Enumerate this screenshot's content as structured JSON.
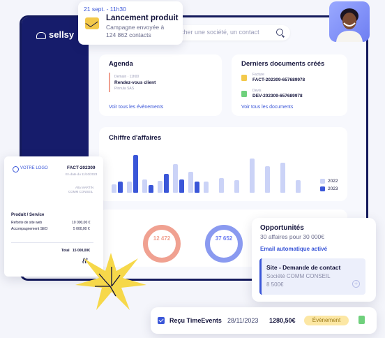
{
  "notification": {
    "date": "21 sept. - 11h30",
    "title": "Lancement produit",
    "line1": "Campagne envoyée à",
    "line2": "124 862 contacts"
  },
  "sidebar": {
    "logo": "sellsy"
  },
  "search": {
    "placeholder": "rcher une société, un contact"
  },
  "agenda": {
    "title": "Agenda",
    "time": "Demain · 11h00",
    "event": "Rendez-vous client",
    "company": "Pinnula SAS",
    "link": "Voir tous les évènements"
  },
  "documents": {
    "title": "Derniers documents créés",
    "items": [
      {
        "type": "Facture",
        "ref": "FACT-202309-657689978",
        "color": "#f3c94b"
      },
      {
        "type": "Devis",
        "ref": "DEV-202309-657689978",
        "color": "#6fd07c"
      }
    ],
    "link": "Voir tous les documents"
  },
  "revenue": {
    "title": "Chiffre d'affaires",
    "legend": [
      {
        "label": "2022",
        "color": "#cbd3f7"
      },
      {
        "label": "2023",
        "color": "#3a56d8"
      }
    ],
    "bars": [
      [
        0.22,
        0.3
      ],
      [
        0.3,
        1.0
      ],
      [
        0.35,
        0.2
      ],
      [
        0.32,
        0.5
      ],
      [
        0.76,
        0.35
      ],
      [
        0.55,
        0.3
      ],
      [
        0.29,
        0.0
      ],
      [
        0.38,
        0.0
      ],
      [
        0.33,
        0.0
      ],
      [
        0.9,
        0.0
      ],
      [
        0.71,
        0.0
      ],
      [
        0.8,
        0.0
      ],
      [
        0.33,
        0.0
      ]
    ]
  },
  "gauges": [
    {
      "value": "12 472",
      "color": "#f0a191"
    },
    {
      "value": "37 652",
      "color": "#8a9af0"
    }
  ],
  "invoice": {
    "logo": "VOTRE LOGO",
    "ref": "FACT-202309",
    "date": "En date du 11/10/2023",
    "client1": "Alta MARTIN",
    "client2": "COMM CONSEIL",
    "section": "Produit / Service",
    "lines": [
      {
        "label": "Refonte de site web",
        "amount": "10 000,00 €"
      },
      {
        "label": "Accompagnement SEO",
        "amount": "5 000,00 €"
      }
    ],
    "total_label": "Total",
    "total": "15 000,00€",
    "signature": "ℓℓ"
  },
  "opportunities": {
    "title": "Opportunités",
    "subtitle": "30 affaires pour 30 000€",
    "auto_email": "Email automatique activé",
    "card_title": "Site - Demande de contact",
    "card_company": "Société COMM CONSEIL",
    "card_amount": "8 500€"
  },
  "receipt": {
    "label": "Reçu TimeEvents",
    "date": "28/11/2023",
    "amount": "1280,50€",
    "badge": "Évènement"
  }
}
